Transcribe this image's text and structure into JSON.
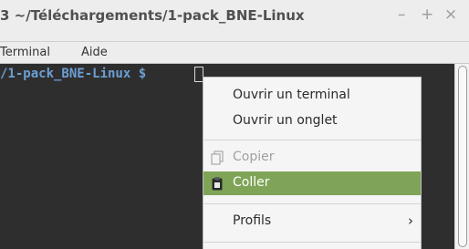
{
  "window": {
    "title": "3 ~/Téléchargements/1-pack_BNE-Linux",
    "controls": {
      "minimize": "–",
      "maximize": "+",
      "close": "×"
    }
  },
  "menubar": {
    "items": [
      {
        "label": "Terminal"
      },
      {
        "label": "Aide"
      }
    ]
  },
  "terminal": {
    "prompt": "/1-pack_BNE-Linux $"
  },
  "context_menu": {
    "items": [
      {
        "label": "Ouvrir un terminal",
        "state": "normal"
      },
      {
        "label": "Ouvrir un onglet",
        "state": "normal"
      },
      {
        "label": "Copier",
        "state": "disabled",
        "icon": "copy-icon"
      },
      {
        "label": "Coller",
        "state": "highlighted",
        "icon": "paste-icon"
      },
      {
        "label": "Profils",
        "state": "normal",
        "submenu": "›"
      }
    ],
    "highlight_color": "#7fa457"
  },
  "colors": {
    "prompt": "#6c9fd3",
    "terminal_bg": "#2e2e2e",
    "titlebar_bg": "#ededed"
  }
}
